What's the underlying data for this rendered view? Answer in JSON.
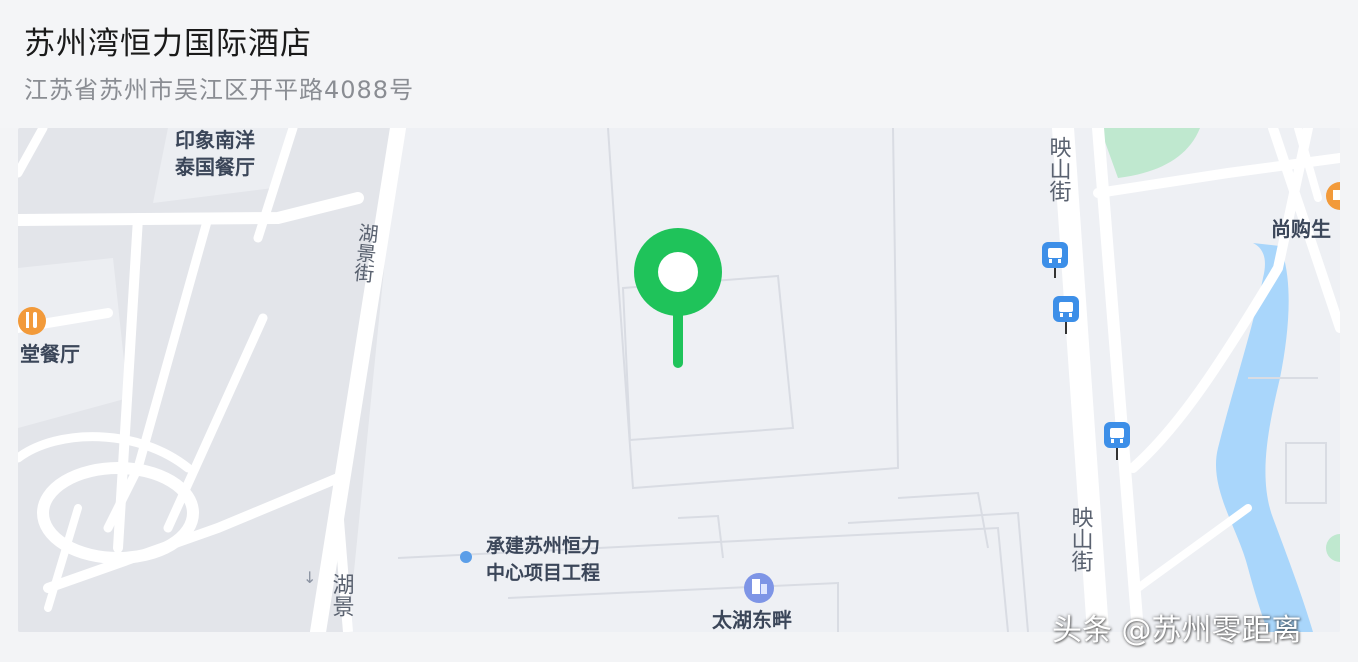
{
  "header": {
    "title": "苏州湾恒力国际酒店",
    "address": "江苏省苏州市吴江区开平路4088号"
  },
  "map": {
    "pin_color": "#1fc35a",
    "water_color": "#a9d6fb",
    "park_color": "#bfe8cf",
    "labels": {
      "restaurant_top_line1": "印象南洋",
      "restaurant_top_line2": "泰国餐厅",
      "restaurant_left": "堂餐厅",
      "street_left_upper": "湖景街",
      "street_left_lower": "湖景",
      "street_right_upper": "映山街",
      "street_right_lower": "映山街",
      "shop_right": "尚购生",
      "project_line1": "承建苏州恒力",
      "project_line2": "中心项目工程",
      "building_bottom": "太湖东畔"
    }
  },
  "watermark": "头条 @苏州零距离"
}
